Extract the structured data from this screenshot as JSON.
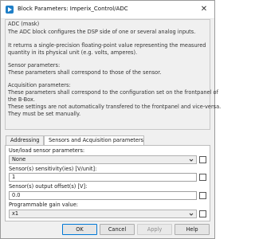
{
  "window": {
    "title": "Block Parameters: Imperix_Control/ADC",
    "close_glyph": "✕",
    "app_icon": "simulink-block-icon"
  },
  "description": {
    "title": "ADC (mask)",
    "lines": [
      "The ADC block configures the DSP side of one or several analog inputs.",
      "",
      "It returns a single-precision floating-point value representing the measured",
      "quantity in its physical unit (e.g. volts, amperes).",
      "",
      "Sensor parameters:",
      "These parameters shall correspond to those of the sensor.",
      "",
      "Acquisition parameters:",
      "These parameters shall correspond to the configuration set on the frontpanel of",
      "the B-Box.",
      "These settings are not automatically transfered to the frontpanel and vice-versa.",
      "They must be set manually."
    ]
  },
  "tabs": [
    {
      "label": "Addressing",
      "active": false
    },
    {
      "label": "Sensors and Acquisition parameters",
      "active": true
    }
  ],
  "fields": [
    {
      "label": "Use/load sensor parameters:",
      "value": "None",
      "type": "select"
    },
    {
      "label": "Sensor(s) sensitivity(ies) [V/unit]:",
      "value": "1",
      "type": "text"
    },
    {
      "label": "Sensor(s) output offset(s) [V]:",
      "value": "0.0",
      "type": "text"
    },
    {
      "label": "Programmable gain value:",
      "value": "x1",
      "type": "select"
    }
  ],
  "buttons": {
    "ok": "OK",
    "cancel": "Cancel",
    "apply": "Apply",
    "help": "Help"
  }
}
